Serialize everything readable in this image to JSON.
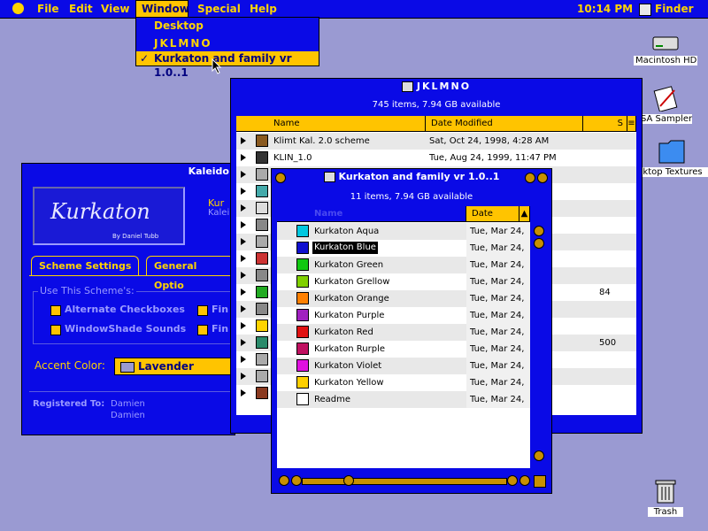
{
  "menubar": {
    "items": [
      "File",
      "Edit",
      "View",
      "Window",
      "Special",
      "Help"
    ],
    "clock": "10:14 PM",
    "app": "Finder"
  },
  "window_menu": {
    "items": [
      "Desktop",
      "JKLMNO",
      "Kurkaton and family vr 1.0..1"
    ],
    "checked_index": 2
  },
  "desktop_icons": {
    "hd": "Macintosh HD",
    "sampler": "SA Sampler",
    "textures": "ktop Textures",
    "trash": "Trash"
  },
  "jk_window": {
    "title": "JKLMNO",
    "info": "745 items, 7.94 GB available",
    "columns": [
      "Name",
      "Date Modified",
      "S"
    ],
    "rows": [
      {
        "name": "Klimt Kal. 2.0 scheme",
        "date": "Sat, Oct 24, 1998, 4:28 AM",
        "size": ""
      },
      {
        "name": "KLIN_1.0",
        "date": "Tue, Aug 24, 1999, 11:47 PM",
        "size": ""
      },
      {
        "name": "",
        "date": "",
        "size": ""
      },
      {
        "name": "",
        "date": "",
        "size": ""
      },
      {
        "name": "",
        "date": "",
        "size": ""
      },
      {
        "name": "",
        "date": "M",
        "size": ""
      },
      {
        "name": "",
        "date": "M",
        "size": ""
      },
      {
        "name": "",
        "date": "M",
        "size": ""
      },
      {
        "name": "",
        "date": "M",
        "size": ""
      },
      {
        "name": "",
        "date": "",
        "size": "84"
      },
      {
        "name": "",
        "date": "",
        "size": ""
      },
      {
        "name": "",
        "date": "PM",
        "size": ""
      },
      {
        "name": "",
        "date": "M",
        "size": "500"
      },
      {
        "name": "",
        "date": "",
        "size": ""
      },
      {
        "name": "",
        "date": "",
        "size": ""
      },
      {
        "name": "",
        "date": "M",
        "size": ""
      }
    ]
  },
  "kal_window": {
    "title": "Kaleido",
    "logo": "Kurkaton",
    "logo_byline": "By Daniel Tubb",
    "side_line1": "Kur",
    "side_line2": "Kalei",
    "tabs": [
      "Scheme Settings",
      "General Optio"
    ],
    "group_label": "Use This Scheme's:",
    "checkboxes": [
      "Alternate Checkboxes",
      "Fin",
      "WindowShade Sounds",
      "Fin"
    ],
    "accent_label": "Accent Color:",
    "accent_value": "Lavender",
    "registered_label": "Registered To:",
    "registered_line1": "Damien",
    "registered_line2": "Damien"
  },
  "kf_window": {
    "title": "Kurkaton and family vr 1.0..1",
    "info": "11 items, 7.94 GB available",
    "columns": [
      "Name",
      "Date Modified"
    ],
    "rows": [
      {
        "name": "Kurkaton Aqua",
        "date": "Tue, Mar 24,",
        "color": "#00c8e0"
      },
      {
        "name": "Kurkaton Blue",
        "date": "Tue, Mar 24,",
        "color": "#1010d0"
      },
      {
        "name": "Kurkaton Green",
        "date": "Tue, Mar 24,",
        "color": "#10c810"
      },
      {
        "name": "Kurkaton Grellow",
        "date": "Tue, Mar 24,",
        "color": "#80d000"
      },
      {
        "name": "Kurkaton Orange",
        "date": "Tue, Mar 24,",
        "color": "#ff8000"
      },
      {
        "name": "Kurkaton Purple",
        "date": "Tue, Mar 24,",
        "color": "#a020c0"
      },
      {
        "name": "Kurkaton Red",
        "date": "Tue, Mar 24,",
        "color": "#e01010"
      },
      {
        "name": "Kurkaton Rurple",
        "date": "Tue, Mar 24,",
        "color": "#c01060"
      },
      {
        "name": "Kurkaton Violet",
        "date": "Tue, Mar 24,",
        "color": "#e010e0"
      },
      {
        "name": "Kurkaton Yellow",
        "date": "Tue, Mar 24,",
        "color": "#ffd000"
      },
      {
        "name": "Readme",
        "date": "Tue, Mar 24,",
        "color": "#ffffff"
      }
    ],
    "selected_index": 1
  },
  "colors": {
    "menubar": "#0a0ae6",
    "accent": "#ffc400",
    "desktop": "#9a9ad2"
  }
}
